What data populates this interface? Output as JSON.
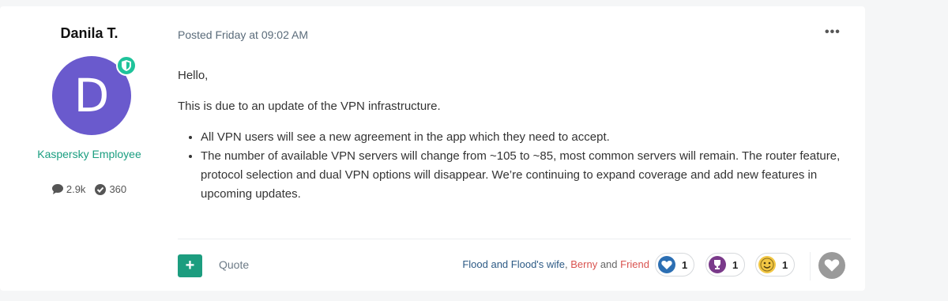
{
  "author": {
    "name": "Danila T.",
    "avatar_letter": "D",
    "role": "Kaspersky Employee",
    "posts_count": "2.9k",
    "reputation": "360"
  },
  "post": {
    "posted": "Posted Friday at 09:02 AM",
    "greeting": "Hello,",
    "intro": "This is due to an update of the VPN infrastructure.",
    "bullets": [
      "All VPN users will see a new agreement in the app which they need to accept.",
      "The number of available VPN servers will change from ~105 to ~85, most common servers will remain. The router feature, protocol selection and dual VPN options will disappear. We’re continuing to expand coverage and add new features in upcoming updates."
    ]
  },
  "footer": {
    "plus_label": "+",
    "quote_label": "Quote",
    "reactors": {
      "part1": "Flood and Flood's wife",
      "sep1": ", ",
      "part2": "Berny",
      "sep2": " and ",
      "part3": "Friend"
    },
    "reactions": [
      {
        "icon": "heart-icon",
        "count": "1"
      },
      {
        "icon": "trophy-icon",
        "count": "1"
      },
      {
        "icon": "smiley-icon",
        "count": "1"
      }
    ]
  },
  "colors": {
    "avatar": "#6a5acd",
    "accent": "#1c9d7f",
    "link": "#2c5a85",
    "highlight": "#d9534f"
  },
  "icons": {
    "more": "ellipsis-icon",
    "badge": "shield-icon",
    "posts": "comment-icon",
    "reputation": "check-circle-icon",
    "react": "heart-icon"
  }
}
